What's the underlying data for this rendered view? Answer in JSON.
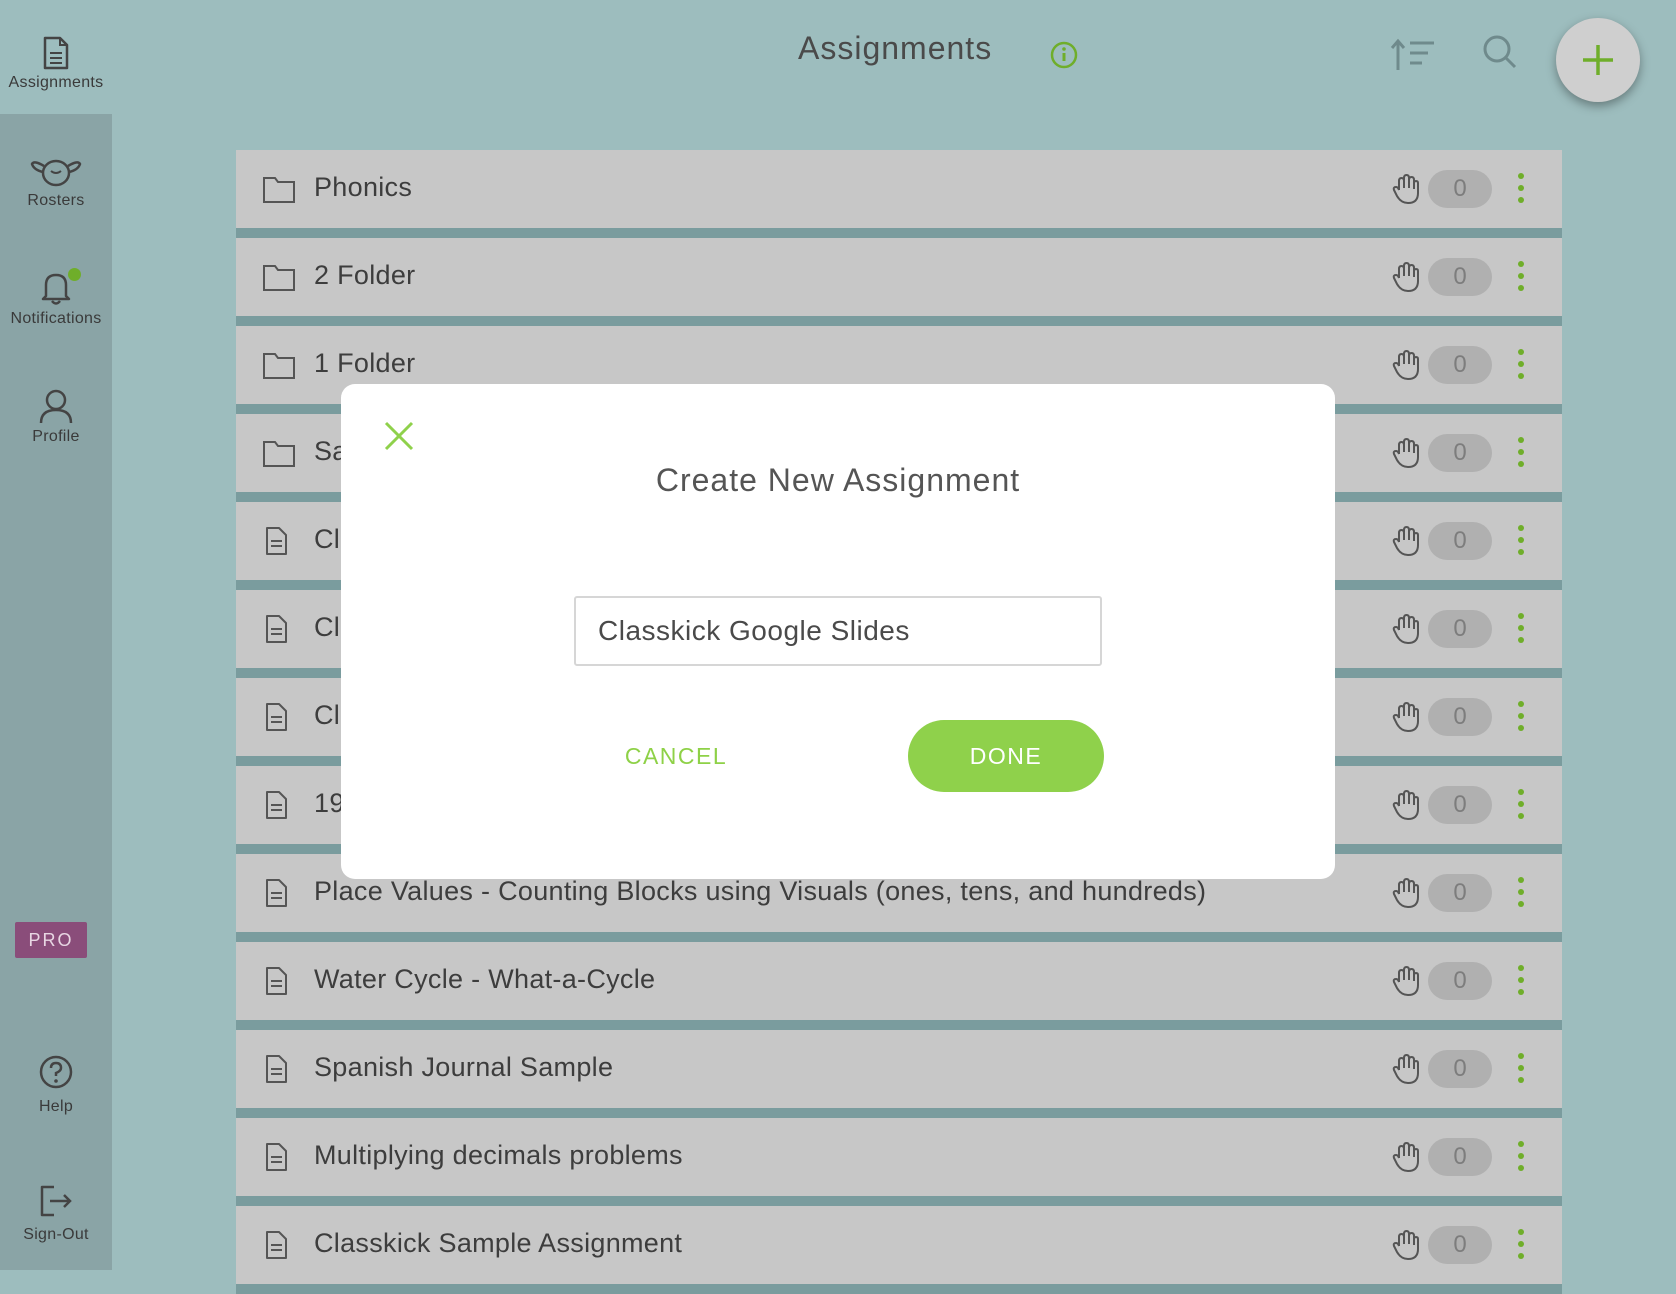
{
  "header": {
    "title": "Assignments"
  },
  "sidebar": {
    "items": [
      {
        "label": "Assignments",
        "icon": "document-icon"
      },
      {
        "label": "Rosters",
        "icon": "rosters-icon"
      },
      {
        "label": "Notifications",
        "icon": "bell-icon"
      },
      {
        "label": "Profile",
        "icon": "profile-icon"
      },
      {
        "label": "Help",
        "icon": "help-icon"
      },
      {
        "label": "Sign-Out",
        "icon": "sign-out-icon"
      }
    ],
    "pro_badge": "PRO"
  },
  "rows": [
    {
      "name": "Phonics",
      "type": "folder",
      "count": "0"
    },
    {
      "name": "2 Folder",
      "type": "folder",
      "count": "0"
    },
    {
      "name": "1 Folder",
      "type": "folder",
      "count": "0"
    },
    {
      "name": "Sa",
      "type": "folder",
      "count": "0"
    },
    {
      "name": "Cl",
      "type": "document",
      "count": "0"
    },
    {
      "name": "Cl",
      "type": "document",
      "count": "0"
    },
    {
      "name": "Cl",
      "type": "document",
      "count": "0"
    },
    {
      "name": "19",
      "type": "document",
      "count": "0"
    },
    {
      "name": "Place Values - Counting Blocks using Visuals (ones, tens, and hundreds)",
      "type": "document",
      "count": "0"
    },
    {
      "name": "Water Cycle - What-a-Cycle",
      "type": "document",
      "count": "0"
    },
    {
      "name": "Spanish Journal Sample",
      "type": "document",
      "count": "0"
    },
    {
      "name": "Multiplying decimals problems",
      "type": "document",
      "count": "0"
    },
    {
      "name": "Classkick Sample Assignment",
      "type": "document",
      "count": "0"
    }
  ],
  "modal": {
    "title": "Create New Assignment",
    "input_value": "Classkick Google Slides",
    "cancel_label": "CANCEL",
    "done_label": "DONE"
  },
  "colors": {
    "accent": "#8fd14b",
    "background": "#9dbdbe",
    "pro": "#8a4d7a",
    "notification_dot": "#6fae2a"
  }
}
